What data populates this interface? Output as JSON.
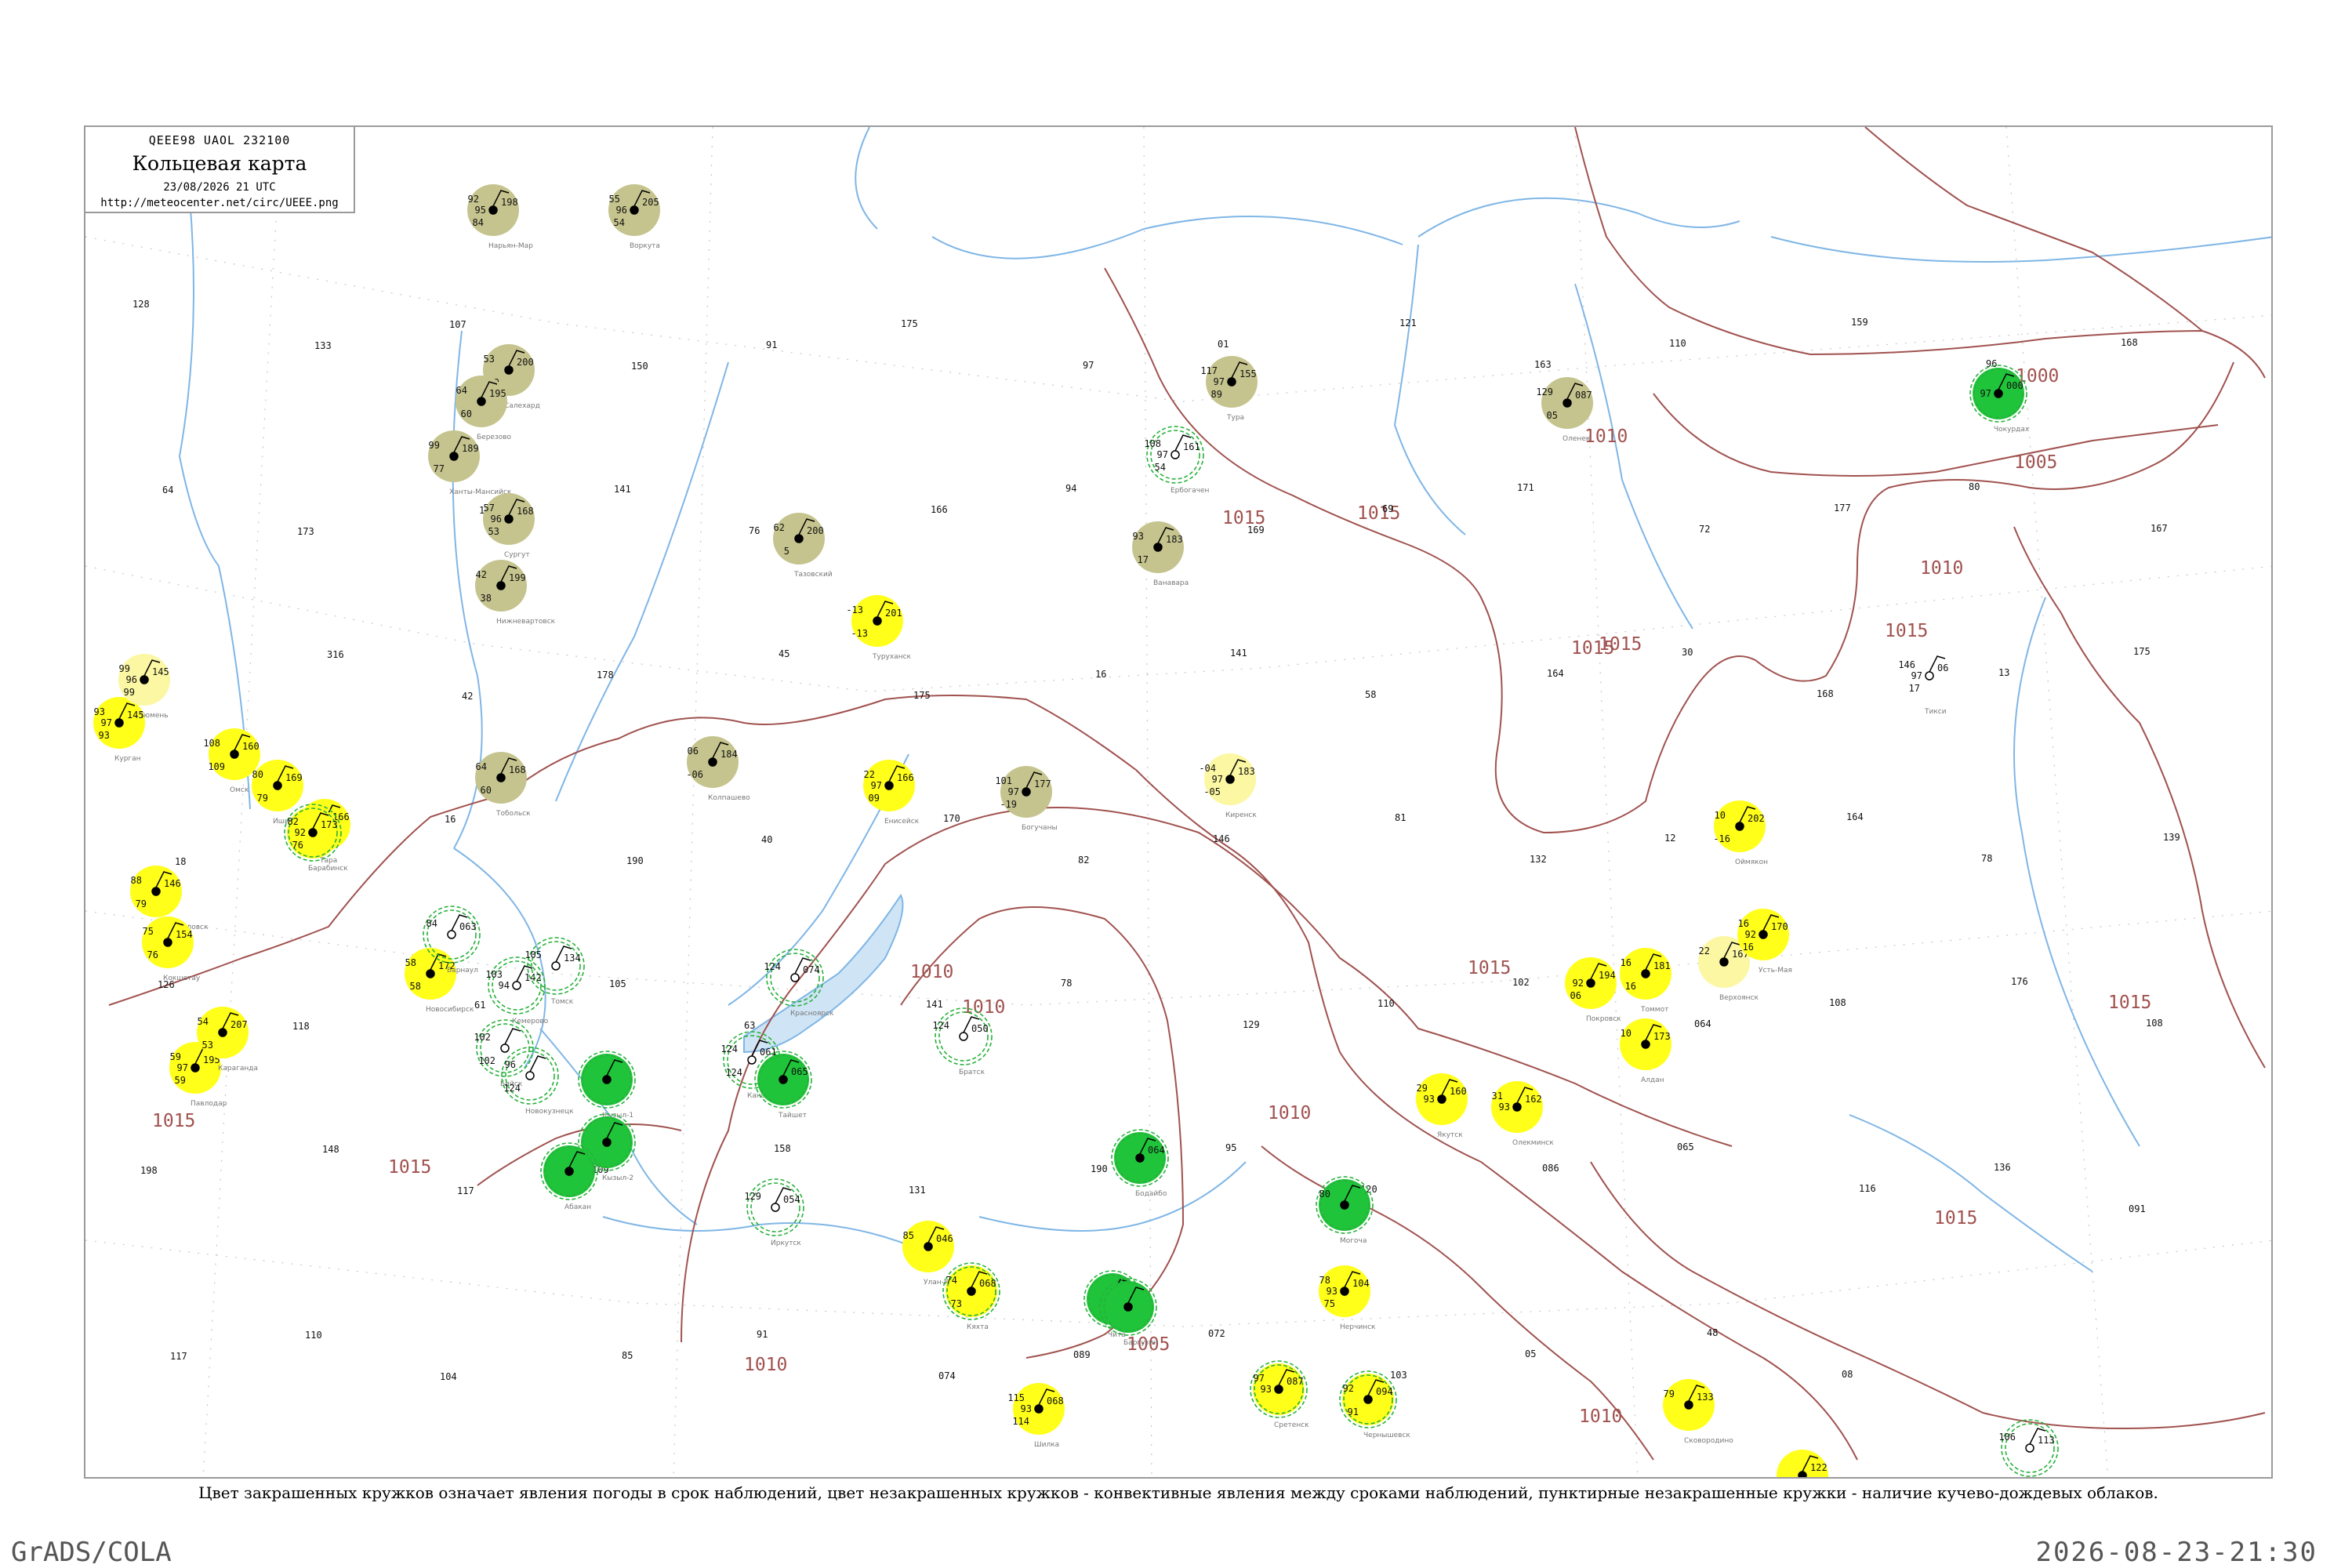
{
  "header": {
    "code": "QEEE98  UAOL  232100",
    "title": "Кольцевая карта",
    "date": "23/08/2026 21 UTC",
    "url": "http://meteocenter.net/circ/UEEE.png"
  },
  "caption": "Цвет закрашенных кружков означает явления погоды в срок наблюдений, цвет незакрашенных кружков - конвективные явления между сроками наблюдений, пунктирные незакрашенные кружки - наличие кучево-дождевых облаков.",
  "footer": {
    "left": "GrADS/COLA",
    "right": "2026-08-23-21:30"
  },
  "colors": {
    "isobar": "#a0524f",
    "river": "#7fb6e6",
    "fog_disk": "#ffff1a",
    "haze_disk": "#c5c48e",
    "rain_disk": "#1fc43a",
    "cb_ring": "#27b13a"
  },
  "isobar_labels": [
    {
      "text": "1010"
    },
    {
      "text": "1015"
    },
    {
      "text": "1015"
    },
    {
      "text": "1015"
    },
    {
      "text": "1015"
    },
    {
      "text": "1005"
    },
    {
      "text": "1000"
    },
    {
      "text": "1010"
    },
    {
      "text": "1010"
    },
    {
      "text": "1015"
    },
    {
      "text": "1010"
    },
    {
      "text": "1015"
    },
    {
      "text": "1015"
    },
    {
      "text": "1015"
    },
    {
      "text": "1005"
    },
    {
      "text": "1010"
    },
    {
      "text": "1015"
    },
    {
      "text": "1015"
    },
    {
      "text": "1010"
    },
    {
      "text": "1010"
    }
  ],
  "stations": [
    {
      "name": "Тикси",
      "top": "146",
      "mid": "97",
      "bot": "17",
      "right": "06",
      "disk": "none",
      "ring": false
    },
    {
      "name": "Нарьян-Мар",
      "top": "92",
      "mid": "95",
      "bot": "84",
      "right": "198",
      "disk": "haze",
      "ring": false
    },
    {
      "name": "Воркута",
      "top": "55",
      "mid": "96",
      "bot": "54",
      "right": "205",
      "disk": "haze",
      "ring": false
    },
    {
      "name": "Салехард",
      "top": "53",
      "mid": "",
      "bot": "49",
      "right": "200",
      "disk": "haze",
      "ring": false
    },
    {
      "name": "Березово",
      "top": "64",
      "mid": "",
      "bot": "60",
      "right": "195",
      "disk": "haze",
      "ring": false
    },
    {
      "name": "Ханты-Мансийск",
      "top": "99",
      "mid": "",
      "bot": "77",
      "right": "189",
      "disk": "haze",
      "ring": false
    },
    {
      "name": "Сургут",
      "top": "57",
      "mid": "96",
      "bot": "53",
      "right": "168",
      "disk": "haze",
      "ring": false
    },
    {
      "name": "Нижневартовск",
      "top": "42",
      "mid": "",
      "bot": "38",
      "right": "199",
      "disk": "haze",
      "ring": false
    },
    {
      "name": "Тазовский",
      "top": "62",
      "mid": "",
      "bot": "5",
      "right": "200",
      "disk": "haze",
      "ring": false
    },
    {
      "name": "Туруханск",
      "top": "-13",
      "mid": "",
      "bot": "-13",
      "right": "201",
      "disk": "fog",
      "ring": false
    },
    {
      "name": "Ванавара",
      "top": "93",
      "mid": "",
      "bot": "17",
      "right": "183",
      "disk": "haze",
      "ring": false
    },
    {
      "name": "Тура",
      "top": "117",
      "mid": "97",
      "bot": "89",
      "right": "155",
      "disk": "haze",
      "ring": false
    },
    {
      "name": "Ербогачен",
      "top": "108",
      "mid": "97",
      "bot": "54",
      "right": "161",
      "disk": "none",
      "ring": true
    },
    {
      "name": "Оленек",
      "top": "129",
      "mid": "",
      "bot": "05",
      "right": "087",
      "disk": "haze",
      "ring": false
    },
    {
      "name": "Чокурдах",
      "top": "",
      "mid": "97",
      "bot": "",
      "right": "000",
      "disk": "rain",
      "ring": true
    },
    {
      "name": "Тобольск",
      "top": "64",
      "mid": "",
      "bot": "60",
      "right": "168",
      "disk": "haze",
      "ring": false
    },
    {
      "name": "Колпашево",
      "top": "06",
      "mid": "",
      "bot": "-06",
      "right": "184",
      "disk": "haze",
      "ring": false
    },
    {
      "name": "Енисейск",
      "top": "22",
      "mid": "97",
      "bot": "09",
      "right": "166",
      "disk": "fog",
      "ring": false
    },
    {
      "name": "Богучаны",
      "top": "101",
      "mid": "97",
      "bot": "-19",
      "right": "177",
      "disk": "haze",
      "ring": false
    },
    {
      "name": "Киренск",
      "top": "-04",
      "mid": "97",
      "bot": "-05",
      "right": "183",
      "disk": "fogpale",
      "ring": false
    },
    {
      "name": "Омск",
      "top": "108",
      "mid": "",
      "bot": "109",
      "right": "160",
      "disk": "fog",
      "ring": false
    },
    {
      "name": "Ишим",
      "top": "80",
      "mid": "",
      "bot": "79",
      "right": "169",
      "disk": "fog",
      "ring": false
    },
    {
      "name": "Тара",
      "top": "54",
      "mid": "",
      "bot": "70",
      "right": "166",
      "disk": "fog",
      "ring": false
    },
    {
      "name": "Курган",
      "top": "93",
      "mid": "97",
      "bot": "93",
      "right": "145",
      "disk": "fog",
      "ring": false
    },
    {
      "name": "Тюмень",
      "top": "99",
      "mid": "96",
      "bot": "99",
      "right": "145",
      "disk": "fogpale",
      "ring": false
    },
    {
      "name": "Барабинск",
      "top": "82",
      "mid": "92",
      "bot": "76",
      "right": "173",
      "disk": "fog",
      "ring": true
    },
    {
      "name": "Петропавловск",
      "top": "88",
      "mid": "",
      "bot": "79",
      "right": "146",
      "disk": "fog",
      "ring": false
    },
    {
      "name": "Кокшетау",
      "top": "75",
      "mid": "",
      "bot": "76",
      "right": "154",
      "disk": "fog",
      "ring": false
    },
    {
      "name": "Павлодар",
      "top": "59",
      "mid": "97",
      "bot": "59",
      "right": "195",
      "disk": "fog",
      "ring": false
    },
    {
      "name": "Караганда",
      "top": "54",
      "mid": "",
      "bot": "53",
      "right": "207",
      "disk": "fog",
      "ring": false
    },
    {
      "name": "Новосибирск",
      "top": "58",
      "mid": "",
      "bot": "58",
      "right": "172",
      "disk": "fog",
      "ring": false
    },
    {
      "name": "Барнаул",
      "top": "84",
      "mid": "",
      "bot": "",
      "right": "063",
      "disk": "none",
      "ring": true
    },
    {
      "name": "Кемерово",
      "top": "103",
      "mid": "94",
      "bot": "",
      "right": "142",
      "disk": "none",
      "ring": true
    },
    {
      "name": "Томск",
      "top": "105",
      "mid": "",
      "bot": "",
      "right": "134",
      "disk": "none",
      "ring": true
    },
    {
      "name": "Бийск",
      "top": "102",
      "mid": "",
      "bot": "102",
      "right": "",
      "disk": "none",
      "ring": true
    },
    {
      "name": "Новокузнецк",
      "top": "96",
      "mid": "",
      "bot": "124",
      "right": "",
      "disk": "none",
      "ring": true
    },
    {
      "name": "Кызыл-1",
      "top": "",
      "mid": "",
      "bot": "",
      "right": "",
      "disk": "rain",
      "ring": true
    },
    {
      "name": "Кызыл-2",
      "top": "",
      "mid": "",
      "bot": "",
      "right": "",
      "disk": "rain",
      "ring": true
    },
    {
      "name": "Абакан",
      "top": "",
      "mid": "",
      "bot": "",
      "right": "",
      "disk": "rain",
      "ring": true
    },
    {
      "name": "Красноярск",
      "top": "124",
      "mid": "",
      "bot": "",
      "right": "074",
      "disk": "none",
      "ring": true
    },
    {
      "name": "Канск",
      "top": "124",
      "mid": "",
      "bot": "124",
      "right": "061",
      "disk": "none",
      "ring": true
    },
    {
      "name": "Тайшет",
      "top": "",
      "mid": "",
      "bot": "",
      "right": "065",
      "disk": "rain",
      "ring": true
    },
    {
      "name": "Братск",
      "top": "124",
      "mid": "",
      "bot": "",
      "right": "050",
      "disk": "none",
      "ring": true
    },
    {
      "name": "Бодайбо",
      "top": "",
      "mid": "",
      "bot": "",
      "right": "064",
      "disk": "rain",
      "ring": true
    },
    {
      "name": "Чита",
      "top": "",
      "mid": "",
      "bot": "",
      "right": "",
      "disk": "rain",
      "ring": true
    },
    {
      "name": "Иркутск",
      "top": "129",
      "mid": "",
      "bot": "",
      "right": "054",
      "disk": "none",
      "ring": true
    },
    {
      "name": "Улан-Удэ",
      "top": "85",
      "mid": "",
      "bot": "",
      "right": "046",
      "disk": "fog",
      "ring": false
    },
    {
      "name": "Кяхта",
      "top": "74",
      "mid": "",
      "bot": "73",
      "right": "068",
      "disk": "fog",
      "ring": true
    },
    {
      "name": "Баргузин",
      "top": "",
      "mid": "",
      "bot": "",
      "right": "",
      "disk": "rain",
      "ring": true
    },
    {
      "name": "Могоча",
      "top": "80",
      "mid": "",
      "bot": "",
      "right": "",
      "disk": "rain",
      "ring": true
    },
    {
      "name": "Нерчинск",
      "top": "78",
      "mid": "93",
      "bot": "75",
      "right": "104",
      "disk": "fog",
      "ring": false
    },
    {
      "name": "Шилка",
      "top": "115",
      "mid": "93",
      "bot": "114",
      "right": "068",
      "disk": "fog",
      "ring": false
    },
    {
      "name": "Сретенск",
      "top": "97",
      "mid": "93",
      "bot": "",
      "right": "087",
      "disk": "fog",
      "ring": true
    },
    {
      "name": "Чернышевск",
      "top": "92",
      "mid": "",
      "bot": "91",
      "right": "094",
      "disk": "fog",
      "ring": true
    },
    {
      "name": "Кыра",
      "top": "108",
      "mid": "",
      "bot": "108",
      "right": "081",
      "disk": "fog",
      "ring": false
    },
    {
      "name": "Якутск",
      "top": "29",
      "mid": "93",
      "bot": "",
      "right": "160",
      "disk": "fog",
      "ring": false
    },
    {
      "name": "Олекминск",
      "top": "31",
      "mid": "93",
      "bot": "",
      "right": "162",
      "disk": "fog",
      "ring": false
    },
    {
      "name": "Алдан",
      "top": "10",
      "mid": "",
      "bot": "",
      "right": "173",
      "disk": "fog",
      "ring": false
    },
    {
      "name": "Томмот",
      "top": "16",
      "mid": "",
      "bot": "16",
      "right": "181",
      "disk": "fog",
      "ring": false
    },
    {
      "name": "Покровск",
      "top": "",
      "mid": "92",
      "bot": "06",
      "right": "194",
      "disk": "fog",
      "ring": false
    },
    {
      "name": "Верхоянск",
      "top": "22",
      "mid": "",
      "bot": "",
      "right": "167",
      "disk": "fogpale",
      "ring": false
    },
    {
      "name": "Усть-Мая",
      "top": "16",
      "mid": "92",
      "bot": "16",
      "right": "170",
      "disk": "fog",
      "ring": false
    },
    {
      "name": "Оймякон",
      "top": "10",
      "mid": "",
      "bot": "-16",
      "right": "202",
      "disk": "fog",
      "ring": false
    },
    {
      "name": "Сковородино",
      "top": "79",
      "mid": "",
      "bot": "",
      "right": "133",
      "disk": "fog",
      "ring": false
    },
    {
      "name": "Тында",
      "top": "",
      "mid": "",
      "bot": "",
      "right": "122",
      "disk": "fog",
      "ring": false
    },
    {
      "name": "Зея",
      "top": "106",
      "mid": "",
      "bot": "",
      "right": "113",
      "disk": "none",
      "ring": true
    }
  ],
  "small_labels": [
    "128",
    "133",
    "107",
    "150",
    "91",
    "175",
    "97",
    "01",
    "121",
    "163",
    "110",
    "159",
    "96",
    "168",
    "64",
    "173",
    "152",
    "141",
    "76",
    "166",
    "94",
    "169",
    "69",
    "171",
    "72",
    "177",
    "80",
    "167",
    "36",
    "316",
    "42",
    "178",
    "45",
    "175",
    "16",
    "141",
    "58",
    "164",
    "30",
    "168",
    "13",
    "175",
    "18",
    "162",
    "16",
    "190",
    "40",
    "170",
    "82",
    "146",
    "81",
    "132",
    "12",
    "164",
    "78",
    "139",
    "126",
    "118",
    "61",
    "105",
    "63",
    "141",
    "78",
    "129",
    "110",
    "102",
    "064",
    "108",
    "176",
    "108",
    "198",
    "148",
    "117",
    "109",
    "158",
    "131",
    "190",
    "95",
    "120",
    "086",
    "065",
    "116",
    "136",
    "091",
    "117",
    "110",
    "104",
    "85",
    "91",
    "074",
    "089",
    "072",
    "103",
    "05",
    "48",
    "08"
  ]
}
